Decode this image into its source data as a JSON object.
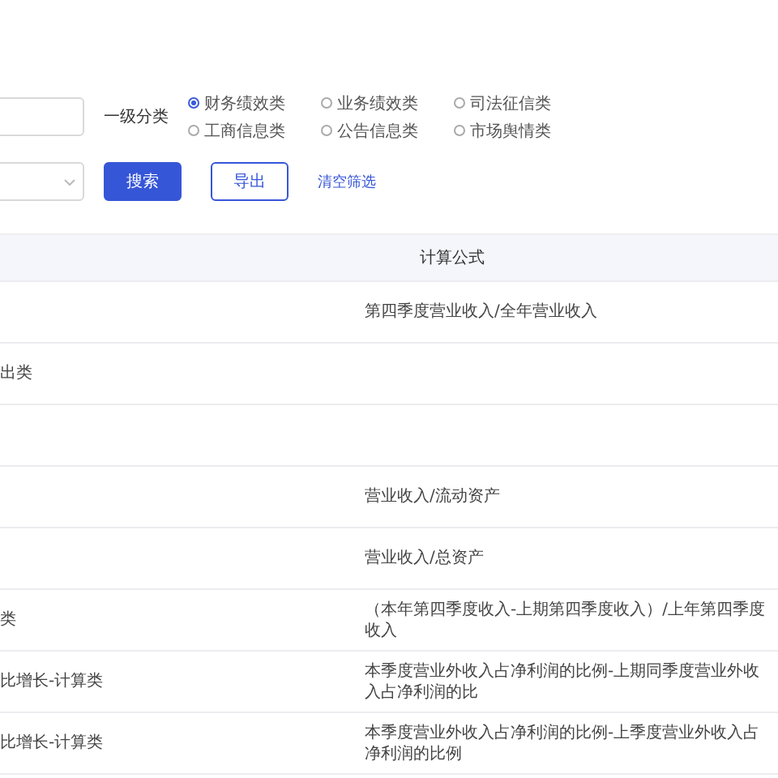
{
  "category": {
    "label": "一级分类",
    "options": [
      {
        "label": "财务绩效类",
        "selected": true
      },
      {
        "label": "业务绩效类",
        "selected": false
      },
      {
        "label": "司法征信类",
        "selected": false
      },
      {
        "label": "工商信息类",
        "selected": false
      },
      {
        "label": "公告信息类",
        "selected": false
      },
      {
        "label": "市场舆情类",
        "selected": false
      }
    ]
  },
  "buttons": [
    {
      "label": "搜索",
      "kind": "primary"
    },
    {
      "label": "导出",
      "kind": "outline"
    },
    {
      "label": "清空筛选",
      "kind": "link"
    }
  ],
  "table": {
    "header_2": "计算公式",
    "rows": [
      {
        "formula": "第四季度营业收入/全年营业收入"
      },
      {
        "column_1": "出类"
      },
      {},
      {
        "formula": "营业收入/流动资产"
      },
      {
        "formula": "营业收入/总资产"
      },
      {
        "column_1": "类",
        "formula": "（本年第四季度收入-上期第四季度收入）/上年第四季度收入"
      },
      {
        "column_1": "比增长-计算类",
        "formula": "本季度营业外收入占净利润的比例-上期同季度营业外收入占净利润的比"
      },
      {
        "column_1": "比增长-计算类",
        "formula": "本季度营业外收入占净利润的比例-上季度营业外收入占净利润的比例"
      }
    ]
  }
}
